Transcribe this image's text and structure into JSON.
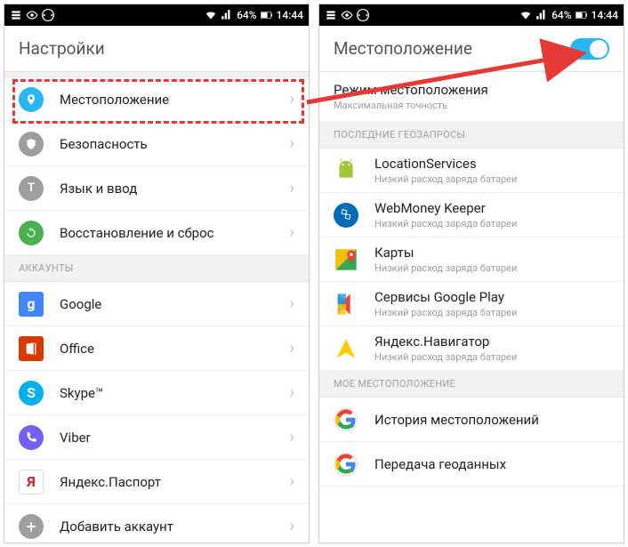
{
  "status": {
    "battery": "64%",
    "time": "14:44"
  },
  "left": {
    "header": "Настройки",
    "items": [
      {
        "label": "Местоположение"
      },
      {
        "label": "Безопасность"
      },
      {
        "label": "Язык и ввод"
      },
      {
        "label": "Восстановление и сброс"
      }
    ],
    "section_accounts": "АККАУНТЫ",
    "accounts": [
      {
        "label": "Google"
      },
      {
        "label": "Office"
      },
      {
        "label": "Skype™"
      },
      {
        "label": "Viber"
      },
      {
        "label": "Яндекс.Паспорт"
      },
      {
        "label": "Добавить аккаунт"
      }
    ]
  },
  "right": {
    "header": "Местоположение",
    "mode": {
      "title": "Режим местоположения",
      "sub": "Максимальная точность"
    },
    "section_recent": "ПОСЛЕДНИЕ ГЕОЗАПРОСЫ",
    "recent": [
      {
        "title": "LocationServices",
        "sub": "Низкий расход заряда батареи"
      },
      {
        "title": "WebMoney Keeper",
        "sub": "Низкий расход заряда батареи"
      },
      {
        "title": "Карты",
        "sub": "Низкий расход заряда батареи"
      },
      {
        "title": "Сервисы Google Play",
        "sub": "Низкий расход заряда батареи"
      },
      {
        "title": "Яндекс.Навигатор",
        "sub": "Низкий расход заряда батареи"
      }
    ],
    "section_my": "МОЕ МЕСТОПОЛОЖЕНИЕ",
    "my": [
      {
        "title": "История местоположений"
      },
      {
        "title": "Передача геоданных"
      }
    ]
  }
}
